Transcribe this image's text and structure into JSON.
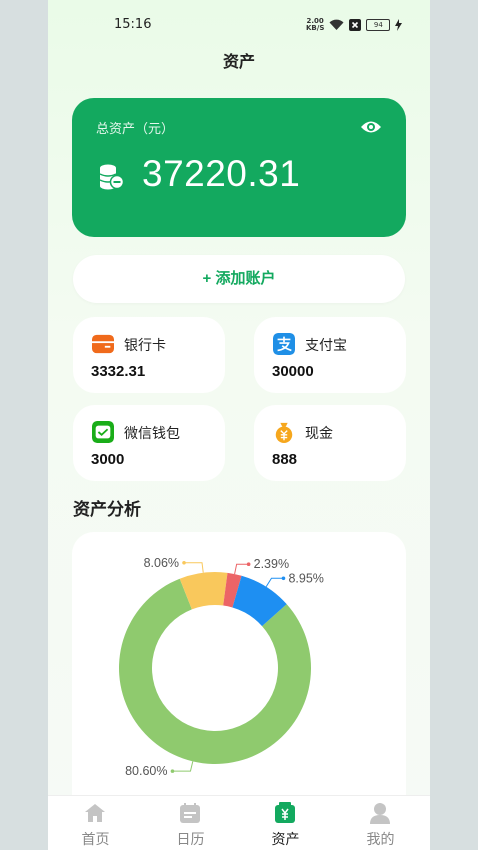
{
  "status_bar": {
    "time": "15:16",
    "net_speed_top": "2.00",
    "net_speed_bottom": "KB/S",
    "battery": "94"
  },
  "page_title": "资产",
  "total": {
    "label": "总资产（元）",
    "value": "37220.31"
  },
  "add_account_label": "+ 添加账户",
  "accounts": [
    {
      "name": "银行卡",
      "value": "3332.31",
      "icon": "bank-card-icon",
      "color": "#f06a1b"
    },
    {
      "name": "支付宝",
      "value": "30000",
      "icon": "alipay-icon",
      "color": "#1f8fe6"
    },
    {
      "name": "微信钱包",
      "value": "3000",
      "icon": "wechat-wallet-icon",
      "color": "#1aad19"
    },
    {
      "name": "现金",
      "value": "888",
      "icon": "cash-bag-icon",
      "color": "#f6a71d"
    }
  ],
  "analysis_title": "资产分析",
  "chart_data": {
    "type": "pie",
    "donut": true,
    "slices": [
      {
        "label": "80.60%",
        "value": 80.6,
        "color": "#8fca6e"
      },
      {
        "label": "8.06%",
        "value": 8.06,
        "color": "#f9c85c"
      },
      {
        "label": "2.39%",
        "value": 2.39,
        "color": "#ec6466"
      },
      {
        "label": "8.95%",
        "value": 8.95,
        "color": "#1e8ff2"
      }
    ]
  },
  "tabs": [
    {
      "label": "首页",
      "icon": "home-icon",
      "active": false
    },
    {
      "label": "日历",
      "icon": "calendar-icon",
      "active": false
    },
    {
      "label": "资产",
      "icon": "wallet-icon",
      "active": true
    },
    {
      "label": "我的",
      "icon": "profile-icon",
      "active": false
    }
  ],
  "colors": {
    "brand": "#13a95f",
    "tab_active": "#13a95f",
    "tab_inactive": "#c4c4c4"
  }
}
